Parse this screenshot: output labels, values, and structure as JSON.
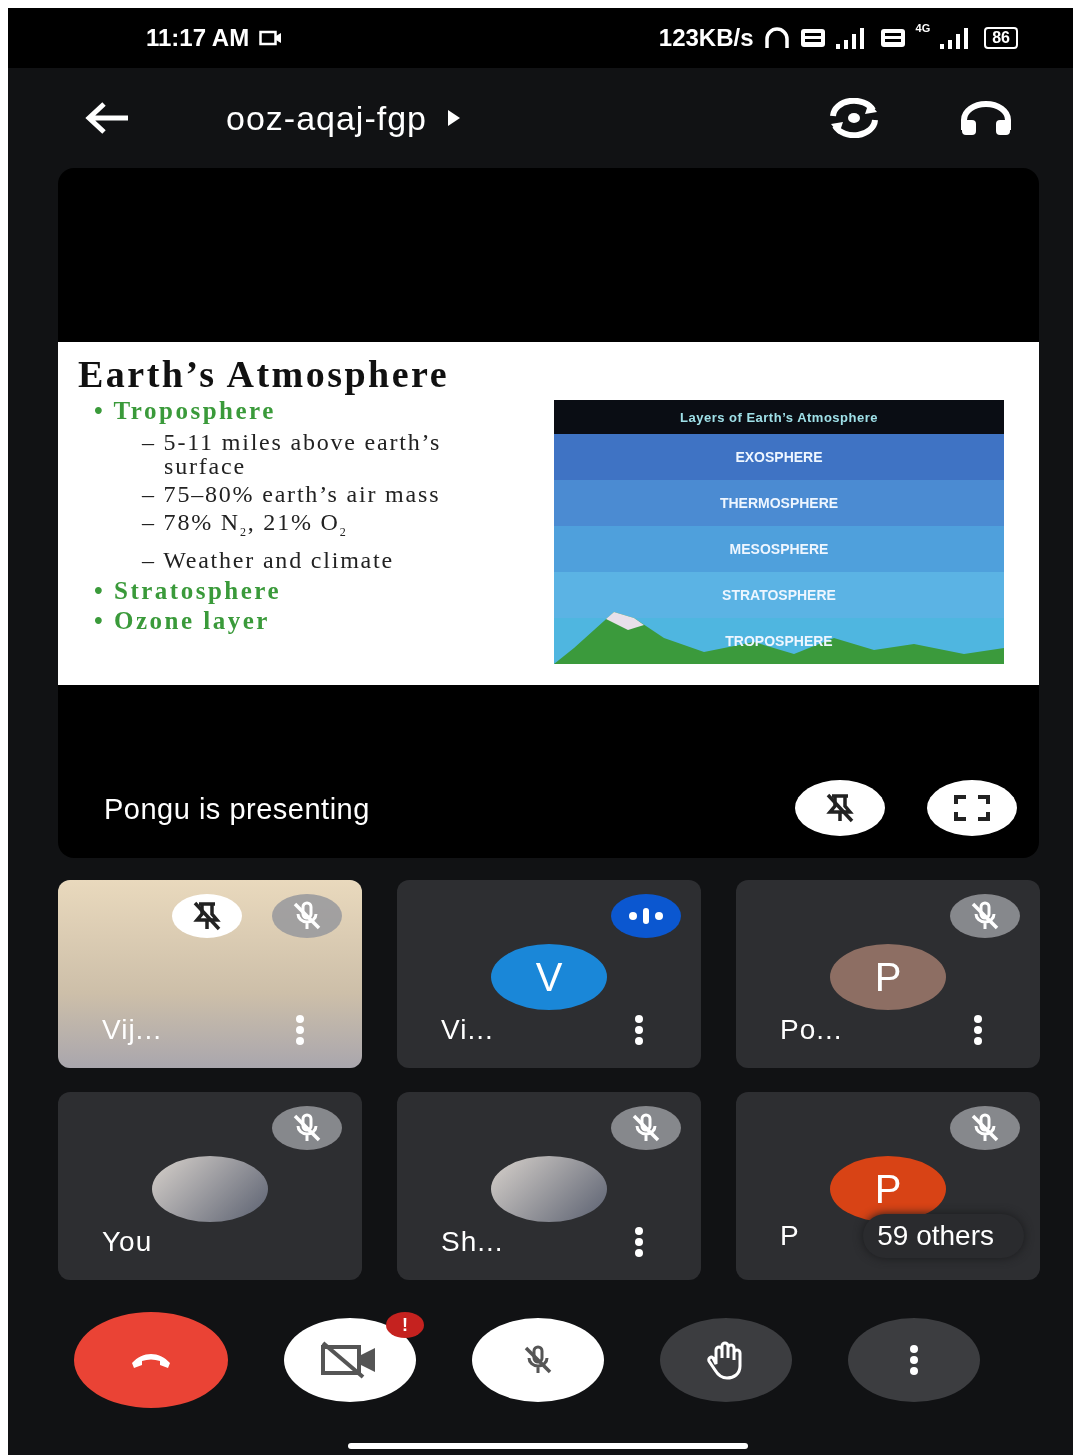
{
  "status_bar": {
    "time": "11:17 AM",
    "net_speed": "123KB/s",
    "network_type": "4G",
    "battery": "86"
  },
  "app_bar": {
    "meeting_code": "ooz-aqaj-fgp"
  },
  "presentation": {
    "presenter_label": "Pongu is presenting",
    "slide": {
      "title": "Earth’s Atmosphere",
      "bullets": [
        {
          "text": "• Troposphere",
          "children": [
            {
              "text": "– 5-11 miles above earth’s surface"
            },
            {
              "text": "– 75–80% earth’s air mass"
            },
            {
              "text": "– 78% N$_{2}$, 21% O$_{2}$"
            },
            {
              "text": "– Weather and climate"
            }
          ]
        },
        {
          "text": "• Stratosphere"
        },
        {
          "text": "• Ozone layer"
        }
      ],
      "figure": {
        "title": "Layers of Earth’s Atmosphere",
        "layers": [
          {
            "name": "EXOSPHERE",
            "color": "#3f73c4"
          },
          {
            "name": "THERMOSPHERE",
            "color": "#4b8bd2"
          },
          {
            "name": "MESOSPHERE",
            "color": "#4fa0dc"
          },
          {
            "name": "STRATOSPHERE",
            "color": "#5bb3e4"
          },
          {
            "name": "TROPOSPHERE",
            "color": "#4fb6e0"
          }
        ]
      }
    }
  },
  "tiles": [
    {
      "name": "Vij...",
      "kind": "video",
      "pinned": true,
      "muted": true,
      "speaking": false,
      "menu": true
    },
    {
      "name": "Vi...",
      "kind": "letter",
      "initial": "V",
      "color": "#1a87d8",
      "pinned": false,
      "muted": false,
      "speaking": true,
      "menu": true
    },
    {
      "name": "Po...",
      "kind": "letter",
      "initial": "P",
      "color": "#8d6e63",
      "pinned": false,
      "muted": true,
      "speaking": false,
      "menu": true
    },
    {
      "name": "You",
      "kind": "photo",
      "pinned": false,
      "muted": true,
      "speaking": false,
      "menu": false
    },
    {
      "name": "Sh...",
      "kind": "photo",
      "pinned": false,
      "muted": true,
      "speaking": false,
      "menu": true
    },
    {
      "name": "P",
      "kind": "letter",
      "initial": "P",
      "color": "#d84315",
      "pinned": false,
      "muted": true,
      "speaking": false,
      "menu": false,
      "overflow": "59 others"
    }
  ],
  "controls": [
    {
      "kind": "end-call"
    },
    {
      "kind": "camera",
      "on": false,
      "alert": "!"
    },
    {
      "kind": "mic",
      "on": false
    },
    {
      "kind": "raise-hand"
    },
    {
      "kind": "more"
    }
  ]
}
